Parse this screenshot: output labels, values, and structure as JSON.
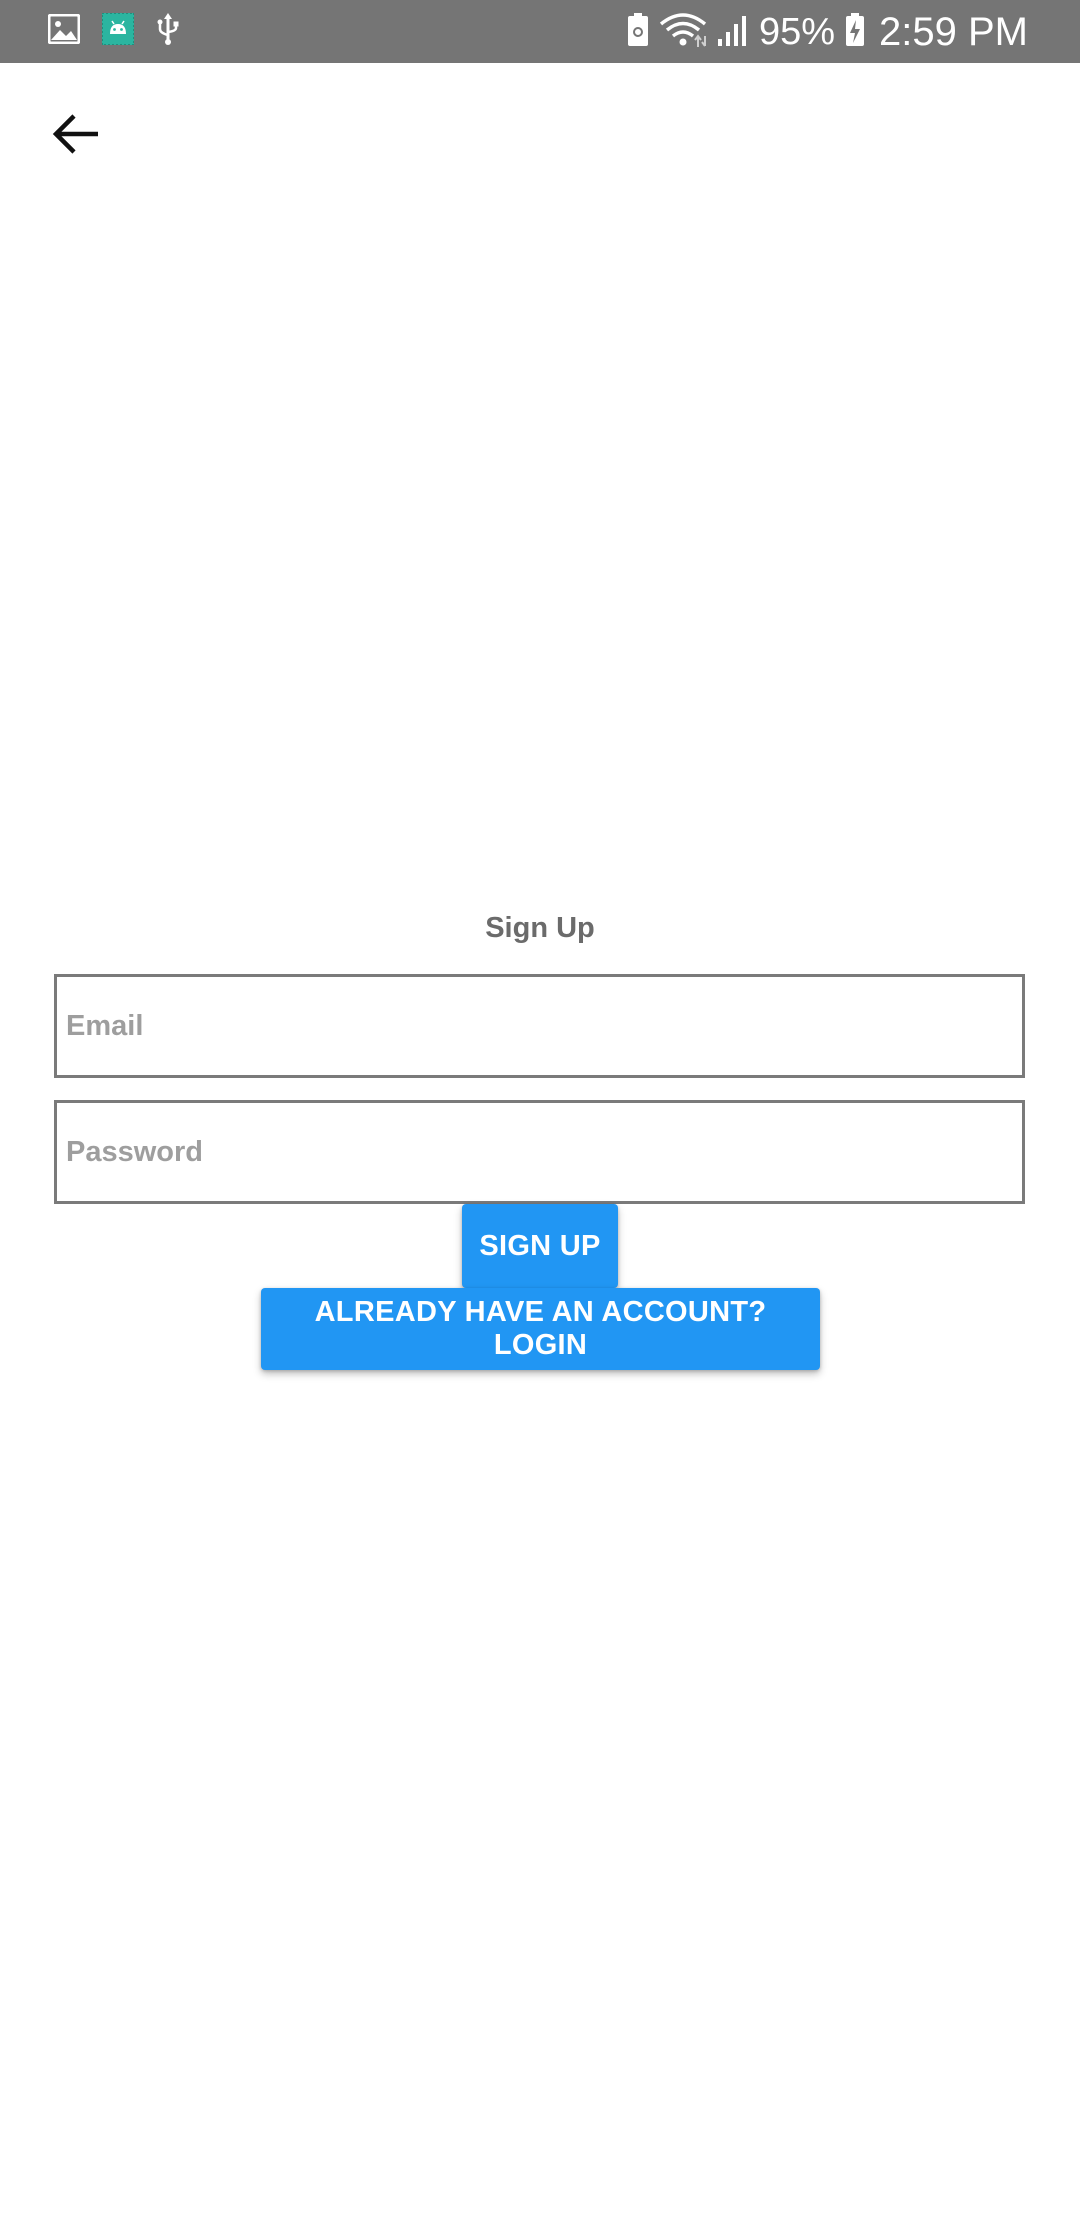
{
  "status_bar": {
    "battery_percent": "95%",
    "time": "2:59 PM",
    "left_icons": [
      "image-icon",
      "android-debug-icon",
      "usb-icon"
    ],
    "right_icons": [
      "battery-saver-icon",
      "wifi-icon",
      "signal-icon",
      "battery-charging-icon"
    ],
    "background_color": "#757575"
  },
  "toolbar": {
    "back_icon": "arrow-back-icon"
  },
  "form": {
    "title": "Sign Up",
    "email": {
      "placeholder": "Email",
      "value": ""
    },
    "password": {
      "placeholder": "Password",
      "value": ""
    },
    "signup_label": "SIGN UP",
    "login_label": "ALREADY HAVE AN ACCOUNT? LOGIN",
    "accent_color": "#2196f3"
  }
}
